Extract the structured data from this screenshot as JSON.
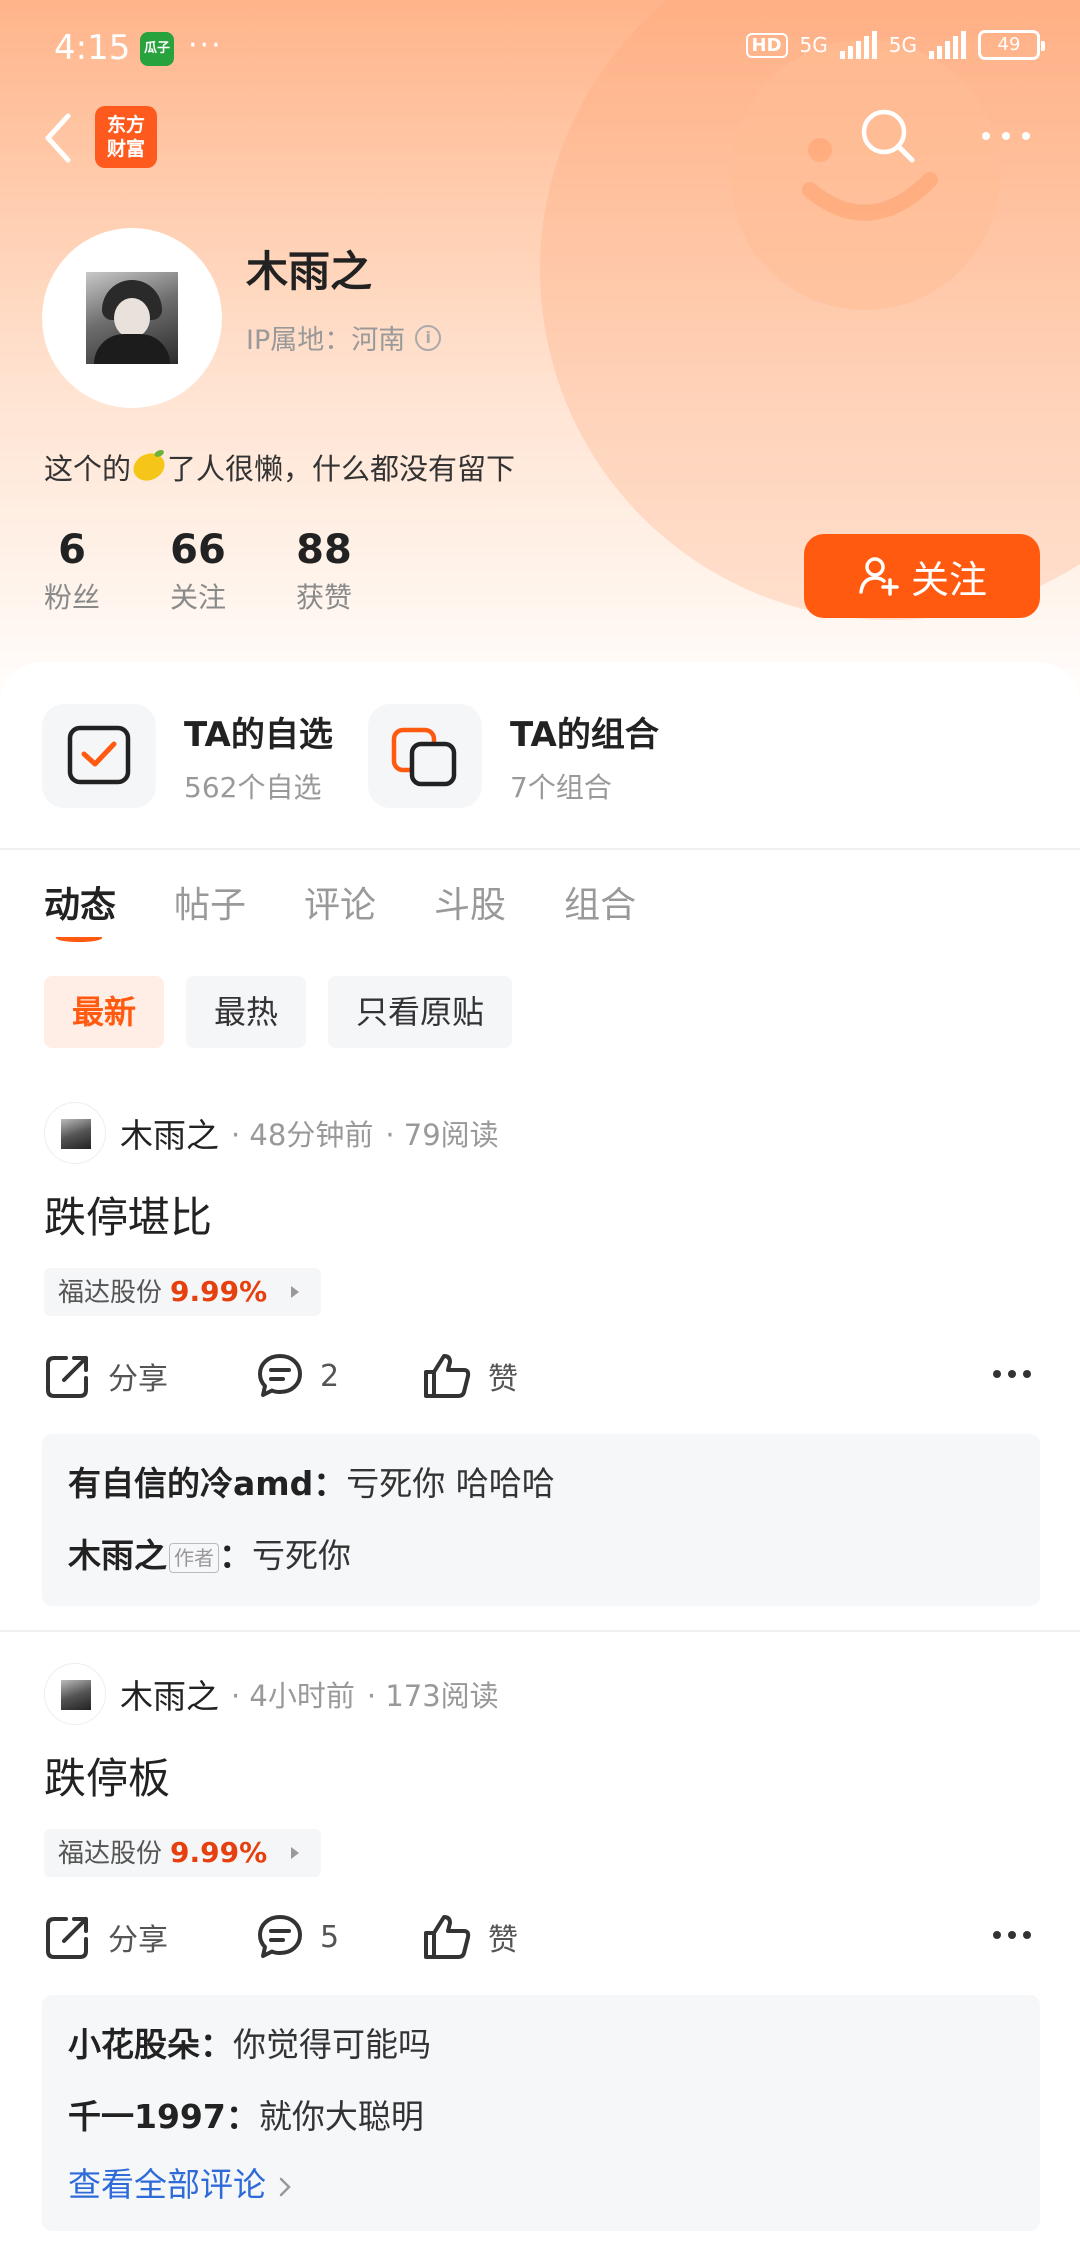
{
  "status_bar": {
    "time": "4:15",
    "app_badge": "瓜子",
    "dots": "···",
    "hd": "HD",
    "signal1": "5G",
    "signal2": "5G",
    "battery": "49"
  },
  "nav": {
    "brand_line1": "东方",
    "brand_line2": "财富",
    "icons": [
      "back-icon",
      "search-icon",
      "more-icon"
    ]
  },
  "profile": {
    "name": "木雨之",
    "ip_location": "IP属地：河南",
    "bio_before": "这个的",
    "bio_after": "了人很懒，什么都没有留下",
    "stats": [
      {
        "value": "6",
        "label": "粉丝"
      },
      {
        "value": "66",
        "label": "关注"
      },
      {
        "value": "88",
        "label": "获赞"
      }
    ],
    "follow_label": "关注"
  },
  "cards": [
    {
      "title": "TA的自选",
      "subtitle": "562个自选"
    },
    {
      "title": "TA的组合",
      "subtitle": "7个组合"
    }
  ],
  "tabs": [
    "动态",
    "帖子",
    "评论",
    "斗股",
    "组合"
  ],
  "active_tab": "动态",
  "filters": [
    "最新",
    "最热",
    "只看原贴"
  ],
  "active_filter": "最新",
  "posts": [
    {
      "author": "木雨之",
      "time": "· 48分钟前",
      "reads": "· 79阅读",
      "title": "跌停堪比",
      "stock": {
        "name": "福达股份",
        "change": "9.99%"
      },
      "share_label": "分享",
      "comment_count": "2",
      "like_label": "赞",
      "comments": [
        {
          "user": "有自信的冷amd",
          "text": "亏死你 哈哈哈"
        },
        {
          "user": "木雨之",
          "badge": "作者",
          "text": "亏死你"
        }
      ]
    },
    {
      "author": "木雨之",
      "time": "· 4小时前",
      "reads": "· 173阅读",
      "title": "跌停板",
      "stock": {
        "name": "福达股份",
        "change": "9.99%"
      },
      "share_label": "分享",
      "comment_count": "5",
      "like_label": "赞",
      "comments": [
        {
          "user": "小花股朵",
          "text": "你觉得可能吗"
        },
        {
          "user": "千一1997",
          "text": "就你大聪明"
        }
      ],
      "view_all": "查看全部评论"
    }
  ],
  "colors": {
    "accent": "#ff5a10",
    "price_up": "#e6400f",
    "link": "#2f6bd8"
  }
}
